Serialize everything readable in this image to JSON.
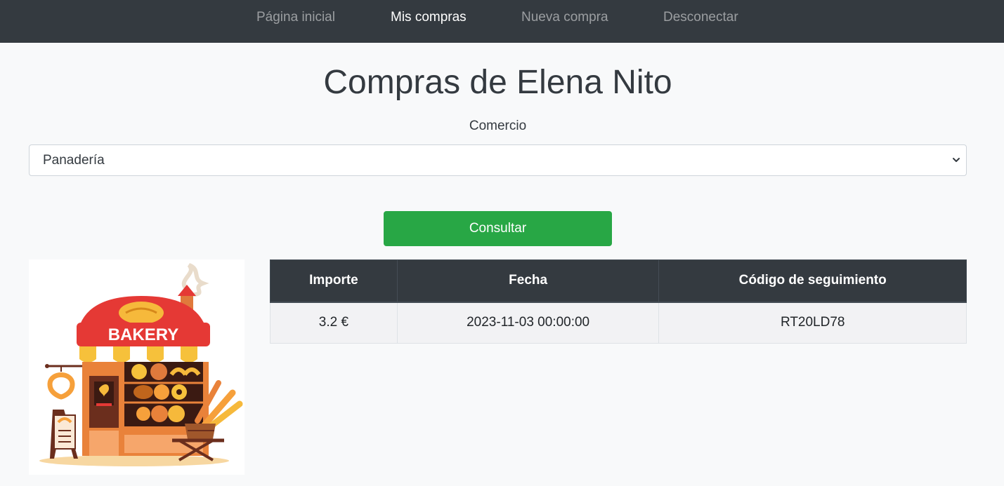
{
  "nav": {
    "items": [
      {
        "label": "Página inicial",
        "active": false
      },
      {
        "label": "Mis compras",
        "active": true
      },
      {
        "label": "Nueva compra",
        "active": false
      },
      {
        "label": "Desconectar",
        "active": false
      }
    ]
  },
  "page": {
    "title": "Compras de Elena Nito"
  },
  "form": {
    "label": "Comercio",
    "selected": "Panadería",
    "submit_label": "Consultar"
  },
  "image": {
    "sign_text": "BAKERY"
  },
  "table": {
    "headers": [
      "Importe",
      "Fecha",
      "Código de seguimiento"
    ],
    "rows": [
      [
        "3.2 €",
        "2023-11-03 00:00:00",
        "RT20LD78"
      ]
    ]
  },
  "colors": {
    "navbar": "#343a40",
    "accent_button": "#28a745",
    "background": "#f8f9fa"
  }
}
